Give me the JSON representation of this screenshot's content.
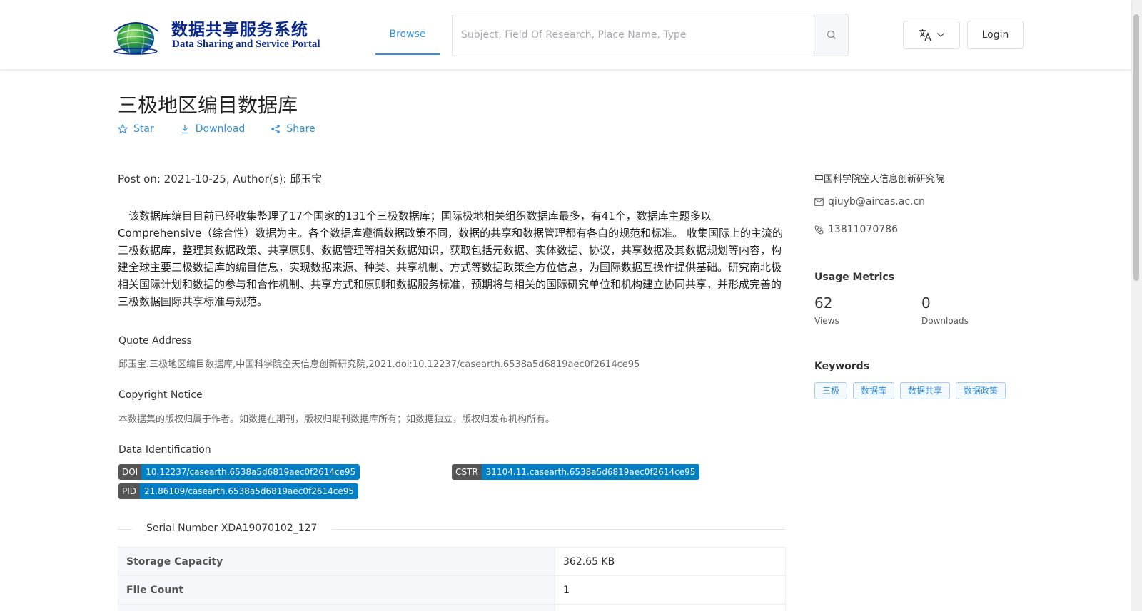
{
  "header": {
    "logo_cn": "数据共享服务系统",
    "logo_en": "Data Sharing and Service Portal",
    "nav_browse": "Browse",
    "search_placeholder": "Subject, Field Of Research, Place Name, Type",
    "login_label": "Login",
    "accent_color": "#3490dc"
  },
  "page": {
    "title": "三极地区编目数据库",
    "actions": {
      "star": "Star",
      "download": "Download",
      "share": "Share"
    },
    "post_line": "Post on: 2021-10-25, Author(s): 邱玉宝",
    "abstract": "该数据库编目目前已经收集整理了17个国家的131个三极数据库；国际极地相关组织数据库最多，有41个，数据库主题多以Comprehensive（综合性）数据为主。各个数据库遵循数据政策不同，数据的共享和数据管理都有各自的规范和标准。 收集国际上的主流的三极数据库，整理其数据政策、共享原则、数据管理等相关数据知识，获取包括元数据、实体数据、协议，共享数据及其数据规划等内容，构建全球主要三极数据库的编目信息，实现数据来源、种类、共享机制、方式等数据政策全方位信息，为国际数据互操作提供基础。研究南北极相关国际计划和数据的参与和合作机制、共享方式和原则和数据服务标准，预期将与相关的国际研究单位和机构建立协同共享，并形成完善的三极数据国际共享标准与规范。",
    "quote": {
      "label": "Quote Address",
      "text": "邱玉宝.三极地区编目数据库,中国科学院空天信息创新研究院,2021.doi:10.12237/casearth.6538a5d6819aec0f2614ce95"
    },
    "copyright": {
      "label": "Copyright Notice",
      "text": "本数据集的版权归属于作者。如数据在期刊，版权归期刊数据库所有；如数据独立，版权归发布机构所有。"
    },
    "identification": {
      "label": "Data Identification",
      "doi_key": "DOI",
      "doi_val": "10.12237/casearth.6538a5d6819aec0f2614ce95",
      "cstr_key": "CSTR",
      "cstr_val": "31104.11.casearth.6538a5d6819aec0f2614ce95",
      "pid_key": "PID",
      "pid_val": "21.86109/casearth.6538a5d6819aec0f2614ce95"
    },
    "serial_number": "Serial Number XDA19070102_127",
    "info_rows": [
      {
        "key": "Storage Capacity",
        "value": "362.65 KB"
      },
      {
        "key": "File Count",
        "value": "1"
      }
    ]
  },
  "sidebar": {
    "institution": "中国科学院空天信息创新研究院",
    "email": "qiuyb@aircas.ac.cn",
    "phone": "13811070786",
    "usage_title": "Usage Metrics",
    "views_count": "62",
    "views_label": "Views",
    "downloads_count": "0",
    "downloads_label": "Downloads",
    "keywords_title": "Keywords",
    "keywords": [
      "三极",
      "数据库",
      "数据共享",
      "数据政策"
    ]
  }
}
